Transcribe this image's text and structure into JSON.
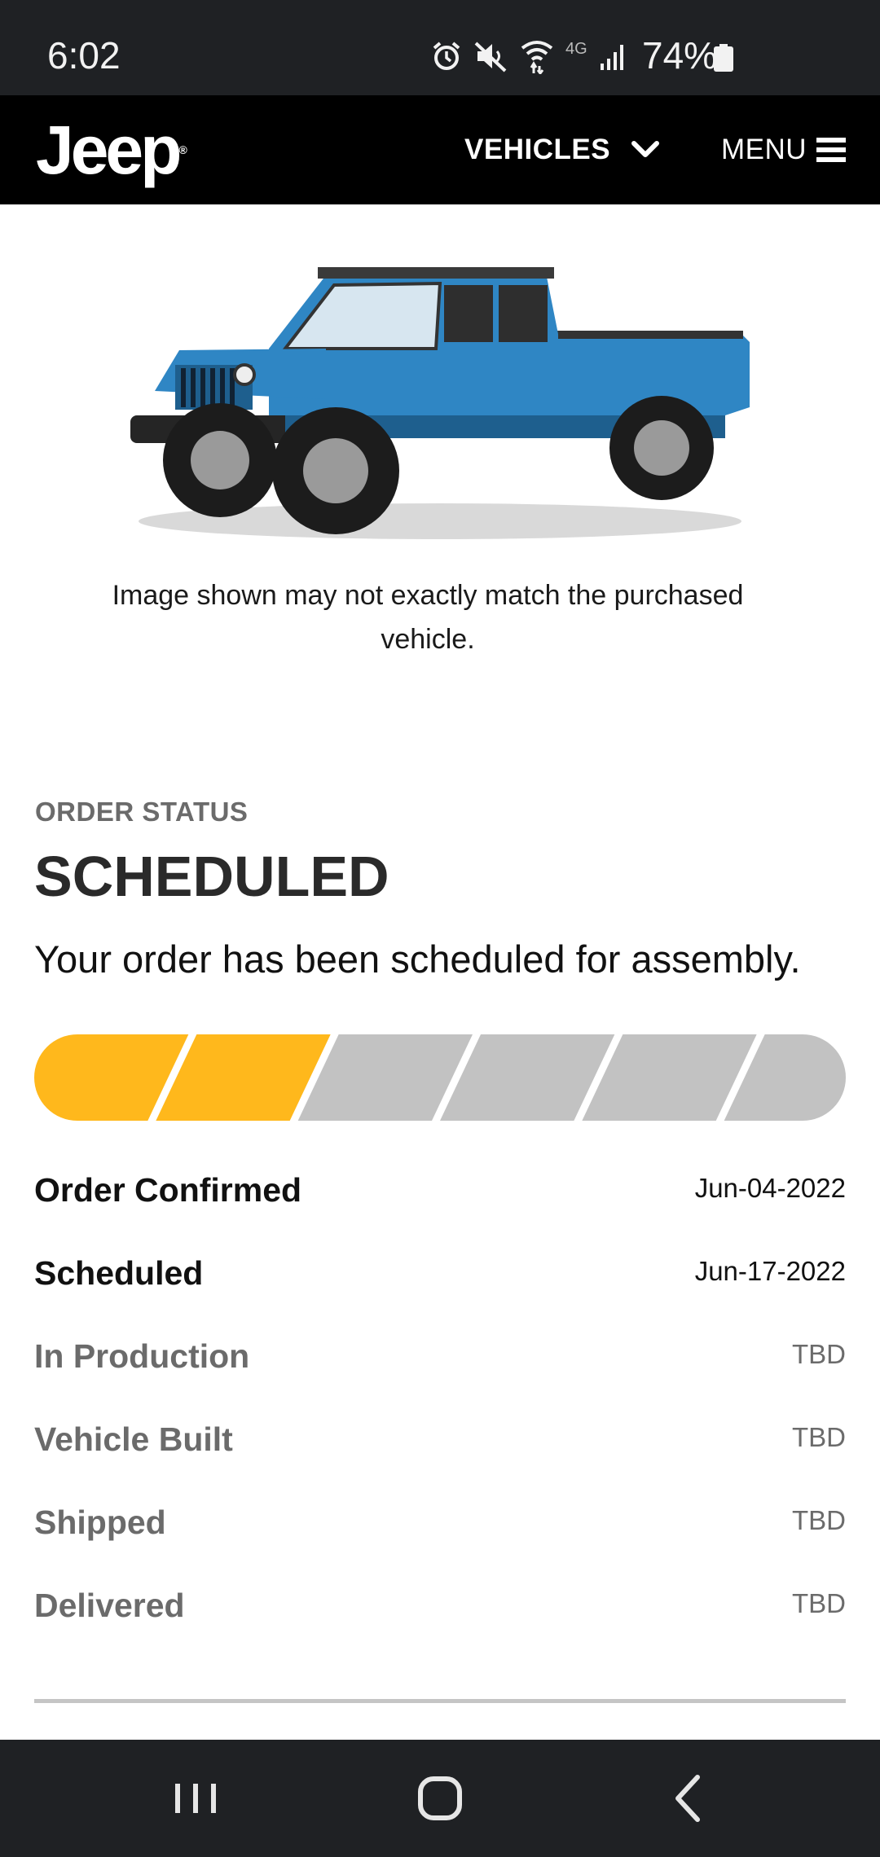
{
  "status_bar": {
    "time": "6:02",
    "battery": "74%",
    "network_label": "4G",
    "icons": [
      "alarm-icon",
      "mute-icon",
      "wifi-icon",
      "signal-icon",
      "battery-icon"
    ]
  },
  "header": {
    "logo": "Jeep",
    "vehicles_label": "VEHICLES",
    "menu_label": "MENU"
  },
  "vehicle": {
    "disclaimer": "Image shown may not exactly match the purchased vehicle.",
    "color": "#2f86c4"
  },
  "order": {
    "eyebrow": "ORDER STATUS",
    "status": "SCHEDULED",
    "message": "Your order has been scheduled for assembly.",
    "progress": {
      "completed": 2,
      "total": 6
    },
    "colors": {
      "complete": "#ffb81c",
      "pending": "#c2c2c2"
    },
    "milestones": [
      {
        "label": "Order Confirmed",
        "date": "Jun-04-2022",
        "done": true
      },
      {
        "label": "Scheduled",
        "date": "Jun-17-2022",
        "done": true
      },
      {
        "label": "In Production",
        "date": "TBD",
        "done": false
      },
      {
        "label": "Vehicle Built",
        "date": "TBD",
        "done": false
      },
      {
        "label": "Shipped",
        "date": "TBD",
        "done": false
      },
      {
        "label": "Delivered",
        "date": "TBD",
        "done": false
      }
    ]
  },
  "nav": {
    "icons": [
      "recent-apps-icon",
      "home-icon",
      "back-icon"
    ]
  }
}
